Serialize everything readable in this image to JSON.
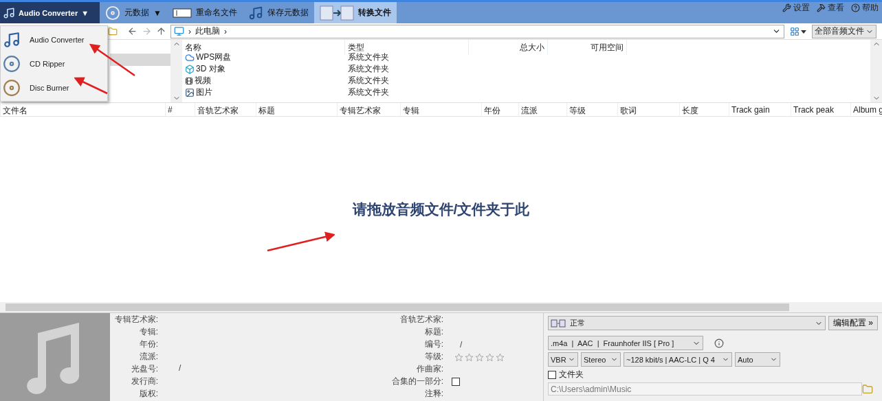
{
  "app_switch": {
    "label": "Audio Converter",
    "caret": "▼"
  },
  "tabs": [
    {
      "label": "元数据",
      "caret": "▼",
      "kind": "disc",
      "selected": false
    },
    {
      "label": "重命名文件",
      "kind": "field",
      "selected": false
    },
    {
      "label": "保存元数据",
      "kind": "save",
      "selected": false
    },
    {
      "label": "转换文件",
      "kind": "convert",
      "selected": true
    }
  ],
  "header_links": [
    {
      "label": "设置",
      "kind": "tools"
    },
    {
      "label": "查看",
      "kind": "hammer"
    },
    {
      "label": "帮助",
      "kind": "help"
    }
  ],
  "app_menu": {
    "items": [
      {
        "label": "Audio Converter",
        "kind": "converter"
      },
      {
        "label": "CD Ripper",
        "kind": "ripper"
      },
      {
        "label": "Disc Burner",
        "kind": "burner"
      }
    ]
  },
  "browser": {
    "path_sep": "›",
    "path": "此电脑",
    "filter": "全部音频文件",
    "columns": [
      "名称",
      "类型",
      "总大小",
      "可用空间"
    ],
    "rows": [
      {
        "name": "WPS网盘",
        "type": "系统文件夹",
        "kind": "cloud"
      },
      {
        "name": "3D 对象",
        "type": "系统文件夹",
        "kind": "cube"
      },
      {
        "name": "视频",
        "type": "系统文件夹",
        "kind": "film"
      },
      {
        "name": "图片",
        "type": "系统文件夹",
        "kind": "image"
      }
    ]
  },
  "track_columns": [
    "文件名",
    "#",
    "音轨艺术家",
    "标题",
    "专辑艺术家",
    "专辑",
    "年份",
    "流派",
    "等级",
    "歌词",
    "长度",
    "Track gain",
    "Track peak",
    "Album g"
  ],
  "drop_hint": "请拖放音频文件/文件夹于此",
  "tags_left": [
    {
      "label": "专辑艺术家:"
    },
    {
      "label": "专辑:"
    },
    {
      "label": "年份:"
    },
    {
      "label": "流派:"
    },
    {
      "label": "光盘号:",
      "value": "/"
    },
    {
      "label": "发行商:"
    },
    {
      "label": "版权:"
    }
  ],
  "tags_right": [
    {
      "label": "音轨艺术家:",
      "kind": "text"
    },
    {
      "label": "标题:",
      "kind": "text"
    },
    {
      "label": "编号:",
      "kind": "text",
      "value": "/"
    },
    {
      "label": "等级:",
      "kind": "stars",
      "stars": 0
    },
    {
      "label": "作曲家:",
      "kind": "text"
    },
    {
      "label": "合集的一部分:",
      "kind": "check",
      "checked": false
    },
    {
      "label": "注释:",
      "kind": "text"
    }
  ],
  "encoder": {
    "preset": "正常",
    "edit_button": "编辑配置 »",
    "format": ".m4a  |  AAC  |  Fraunhofer IIS [ Pro ]",
    "options": [
      "VBR",
      "Stereo",
      "~128 kbit/s | AAC-LC | Q 4",
      "Auto"
    ],
    "folder": {
      "label": "文件夹",
      "checked": false
    },
    "output_path": "C:\\Users\\admin\\Music"
  },
  "annotations": [
    {
      "kind": "arrow"
    },
    {
      "kind": "arrow"
    },
    {
      "kind": "arrow"
    }
  ]
}
